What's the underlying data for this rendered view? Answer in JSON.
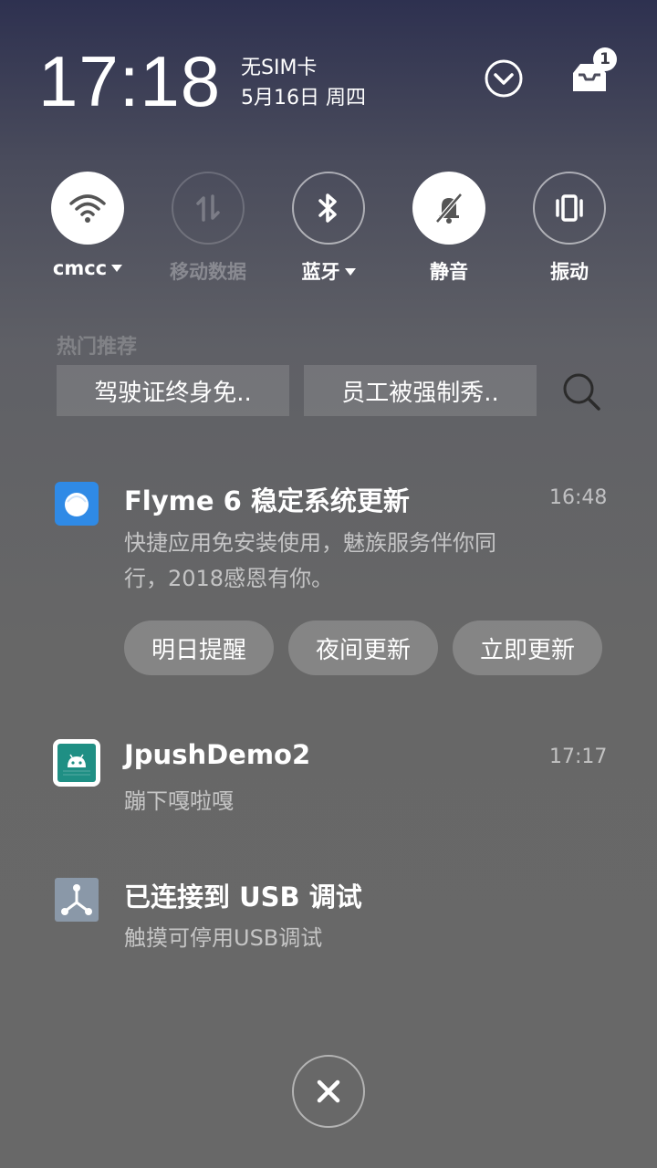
{
  "status": {
    "time": "17:18",
    "carrier": "无SIM卡",
    "date": "5月16日 周四",
    "notification_count": "1"
  },
  "toggles": [
    {
      "label": "cmcc",
      "icon": "wifi-icon",
      "state": "on",
      "has_dropdown": true
    },
    {
      "label": "移动数据",
      "icon": "mobile-data-icon",
      "state": "disabled",
      "has_dropdown": false
    },
    {
      "label": "蓝牙",
      "icon": "bluetooth-icon",
      "state": "off",
      "has_dropdown": true
    },
    {
      "label": "静音",
      "icon": "mute-bell-icon",
      "state": "on",
      "has_dropdown": false
    },
    {
      "label": "振动",
      "icon": "vibrate-icon",
      "state": "off",
      "has_dropdown": false
    }
  ],
  "hot": {
    "title": "热门推荐",
    "chips": [
      "驾驶证终身免..",
      "员工被强制秀.."
    ]
  },
  "notifications": [
    {
      "app_icon": "flyme-update-icon",
      "title": "Flyme 6 稳定系统更新",
      "time": "16:48",
      "body_line1": "快捷应用免安装使用，魅族服务伴你同",
      "body_line2": "行，2018感恩有你。",
      "actions": [
        "明日提醒",
        "夜间更新",
        "立即更新"
      ]
    },
    {
      "app_icon": "android-app-icon",
      "title": "JpushDemo2",
      "time": "17:17",
      "body": "蹦下嘎啦嘎"
    },
    {
      "app_icon": "usb-debug-icon",
      "title": "已连接到 USB 调试",
      "body": "触摸可停用USB调试"
    }
  ],
  "colors": {
    "toggle_on_bg": "#ffffff",
    "flyme_blue": "#2f8ae6",
    "android_teal": "#1f8f84",
    "usb_icon_bg": "#8a98a8"
  }
}
